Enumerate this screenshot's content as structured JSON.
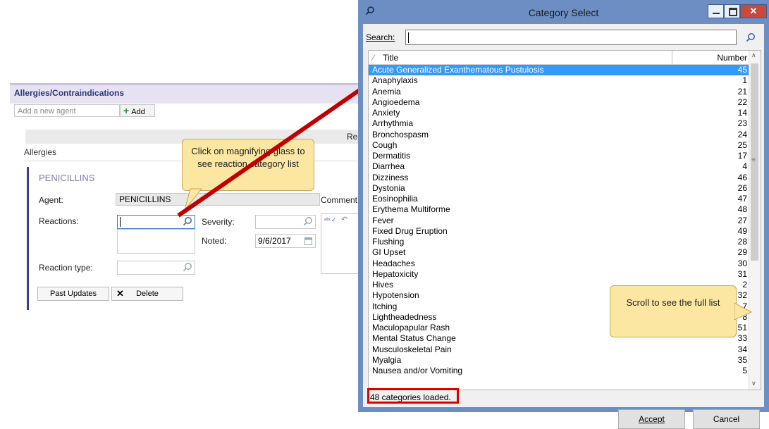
{
  "allergies_panel": {
    "title": "Allergies/Contraindications",
    "add_agent_placeholder": "Add a new agent",
    "add_label": "Add",
    "band_label": "Rea",
    "section_label": "Allergies",
    "card_title": "PENICILLINS",
    "agent_label": "Agent:",
    "agent_value": "PENICILLINS",
    "comment_label": "Comment",
    "reactions_label": "Reactions:",
    "severity_label": "Severity:",
    "noted_label": "Noted:",
    "noted_value": "9/6/2017",
    "reaction_type_label": "Reaction type:",
    "past_updates_label": "Past Updates",
    "delete_label": "Delete"
  },
  "callouts": {
    "magnify": "Click on magnifying glass to see reaction category list",
    "scroll": "Scroll to see the full list"
  },
  "dialog": {
    "title": "Category Select",
    "search_label": "Search:",
    "search_value": "",
    "columns": {
      "title": "Title",
      "number": "Number"
    },
    "rows": [
      {
        "title": "Acute Generalized Exanthematous Pustulosis",
        "number": "45"
      },
      {
        "title": "Anaphylaxis",
        "number": "1"
      },
      {
        "title": "Anemia",
        "number": "21"
      },
      {
        "title": "Angioedema",
        "number": "22"
      },
      {
        "title": "Anxiety",
        "number": "14"
      },
      {
        "title": "Arrhythmia",
        "number": "23"
      },
      {
        "title": "Bronchospasm",
        "number": "24"
      },
      {
        "title": "Cough",
        "number": "25"
      },
      {
        "title": "Dermatitis",
        "number": "17"
      },
      {
        "title": "Diarrhea",
        "number": "4"
      },
      {
        "title": "Dizziness",
        "number": "46"
      },
      {
        "title": "Dystonia",
        "number": "26"
      },
      {
        "title": "Eosinophilia",
        "number": "47"
      },
      {
        "title": "Erythema Multiforme",
        "number": "48"
      },
      {
        "title": "Fever",
        "number": "27"
      },
      {
        "title": "Fixed Drug Eruption",
        "number": "49"
      },
      {
        "title": "Flushing",
        "number": "28"
      },
      {
        "title": "GI Upset",
        "number": "29"
      },
      {
        "title": "Headaches",
        "number": "30"
      },
      {
        "title": "Hepatoxicity",
        "number": "31"
      },
      {
        "title": "Hives",
        "number": "2"
      },
      {
        "title": "Hypotension",
        "number": "32"
      },
      {
        "title": "Itching",
        "number": "7"
      },
      {
        "title": "Lightheadedness",
        "number": "8"
      },
      {
        "title": "Maculopapular Rash",
        "number": "51"
      },
      {
        "title": "Mental Status Change",
        "number": "33"
      },
      {
        "title": "Musculoskeletal Pain",
        "number": "34"
      },
      {
        "title": "Myalgia",
        "number": "35"
      },
      {
        "title": "Nausea and/or Vomiting",
        "number": "5"
      }
    ],
    "status": "48 categories loaded.",
    "accept_label": "Accept",
    "cancel_label": "Cancel"
  },
  "colors": {
    "dialog_frame": "#6c8ec2",
    "selection": "#3399ff",
    "callout_fill": "#fbe6a2",
    "highlight_box": "#e00000",
    "arrow": "#c00000"
  }
}
